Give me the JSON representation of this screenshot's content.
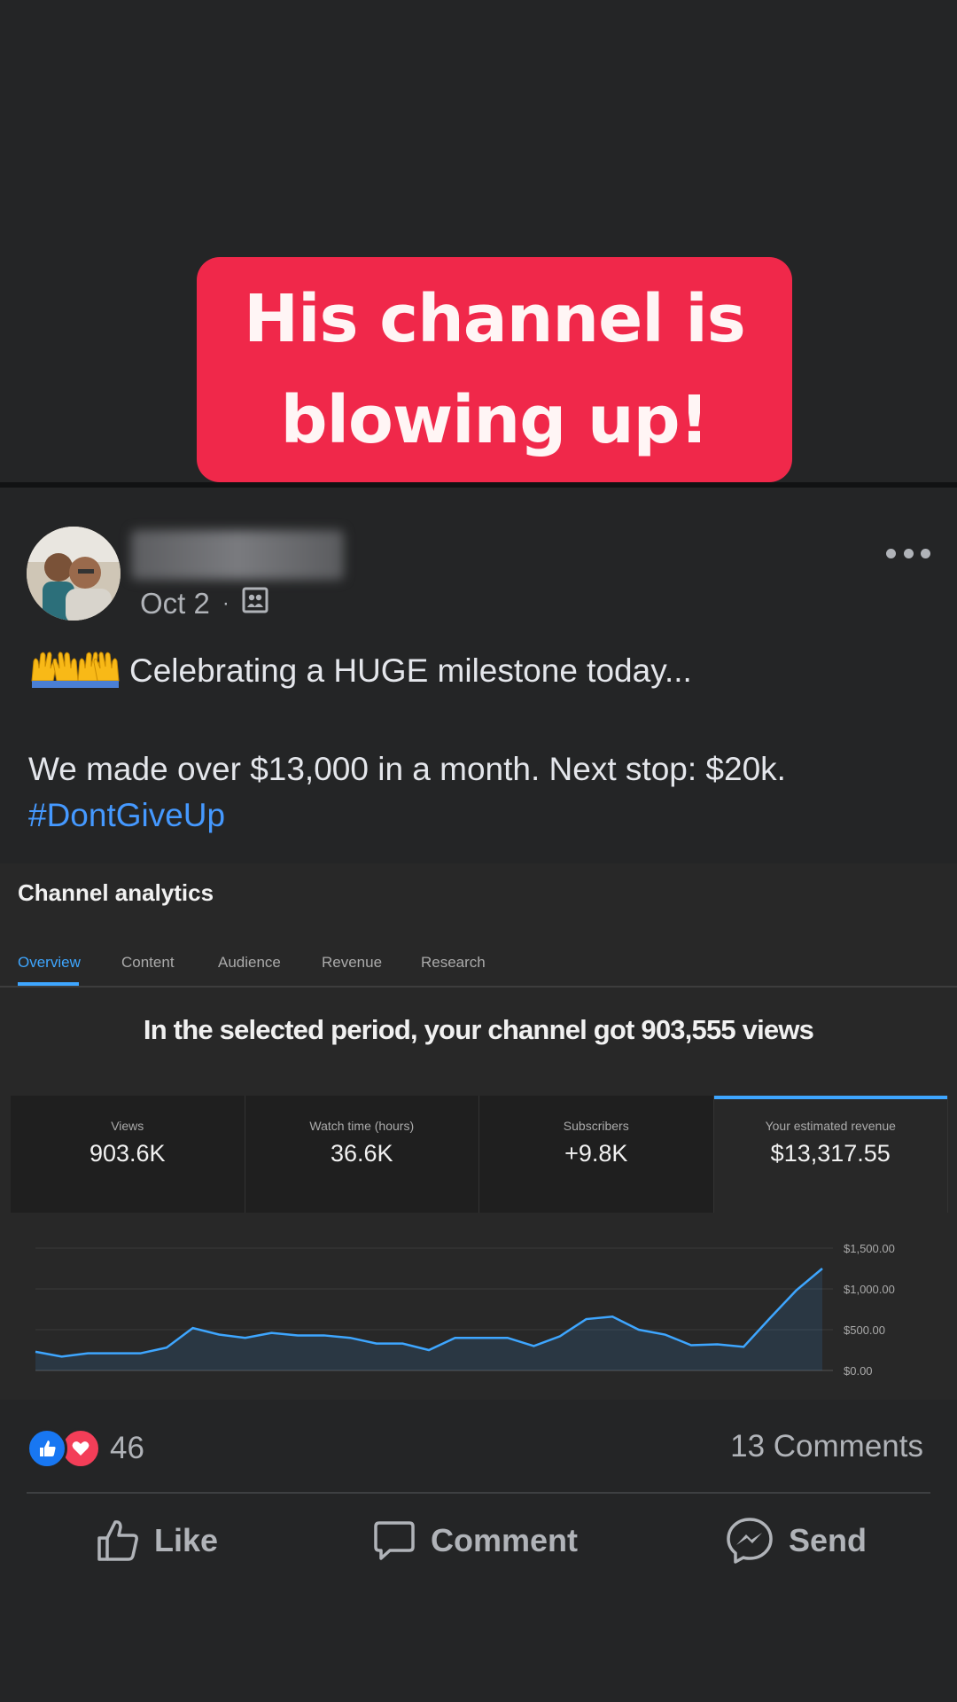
{
  "caption": {
    "line1": "His channel is",
    "line2": "blowing up!"
  },
  "post": {
    "date": "Oct 2",
    "dot": "·",
    "line1": "Celebrating a HUGE milestone today...",
    "line2": "We made over $13,000 in a month. Next stop: $20k.",
    "hashtag": "#DontGiveUp"
  },
  "analytics": {
    "title": "Channel analytics",
    "tabs": [
      "Overview",
      "Content",
      "Audience",
      "Revenue",
      "Research"
    ],
    "active_tab": "Overview",
    "period_text": "In the selected period, your channel got 903,555 views",
    "cards": [
      {
        "label": "Views",
        "value": "903.6K"
      },
      {
        "label": "Watch time (hours)",
        "value": "36.6K"
      },
      {
        "label": "Subscribers",
        "value": "+9.8K"
      },
      {
        "label": "Your estimated revenue",
        "value": "$13,317.55"
      }
    ]
  },
  "chart_data": {
    "type": "area",
    "ylim": [
      0,
      1500
    ],
    "yticks": [
      "$1,500.00",
      "$1,000.00",
      "$500.00",
      "$0.00"
    ],
    "series": [
      {
        "values": [
          230,
          170,
          210,
          210,
          210,
          280,
          520,
          440,
          400,
          460,
          430,
          430,
          400,
          330,
          330,
          250,
          400,
          400,
          400,
          300,
          420,
          630,
          660,
          500,
          440,
          310,
          320,
          290,
          640,
          980,
          1250
        ]
      }
    ],
    "line_color": "#3ea6ff"
  },
  "reactions": {
    "count": "46",
    "comments": "13 Comments"
  },
  "actions": {
    "like": "Like",
    "comment": "Comment",
    "send": "Send"
  }
}
